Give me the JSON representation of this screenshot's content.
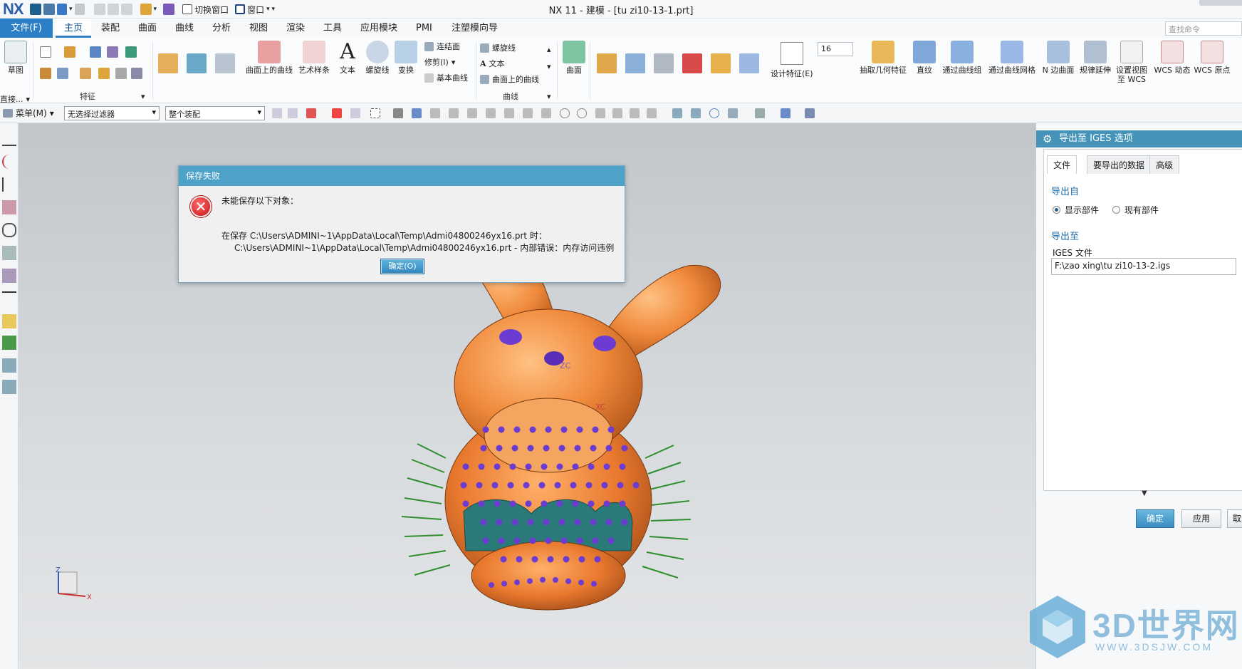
{
  "app": {
    "logo": "NX",
    "window_title": "NX 11 - 建模 - [tu zi10-13-1.prt]"
  },
  "quick_access": {
    "switch_window": "切换窗口",
    "window": "窗口"
  },
  "menu": {
    "file": "文件(F)",
    "tabs": [
      "主页",
      "装配",
      "曲面",
      "曲线",
      "分析",
      "视图",
      "渲染",
      "工具",
      "应用模块",
      "PMI",
      "注塑模向导"
    ],
    "search_placeholder": "查找命令"
  },
  "ribbon": {
    "sketch": "草图",
    "direct_label": "直接...",
    "feature_group": "特征",
    "curve_on_surface": "曲面上的曲线",
    "art_spline": "艺术样条",
    "text": "文本",
    "helix": "螺旋线",
    "transform": "变换",
    "bridge_curve": "连结面",
    "trim": "修剪(I)",
    "basic_curves": "基本曲线",
    "helix_small": "螺旋线",
    "text_small": "文本",
    "curve_on_surface_small": "曲面上的曲线",
    "curve_group": "曲线",
    "surface": "曲面",
    "design_feature": "设计特征(E)",
    "font_size": "16",
    "extract_geometry": "抽取几何特征",
    "ruled": "直纹",
    "through_curves": "通过曲线组",
    "through_curve_mesh": "通过曲线网格",
    "n_sided": "N 边曲面",
    "law_extension": "规律延伸",
    "set_view_wcs_1": "设置视图",
    "set_view_wcs_2": "至 WCS",
    "wcs_dynamic": "WCS 动态",
    "wcs_origin": "WCS 原点"
  },
  "selection_bar": {
    "menu": "菜单(M)",
    "filter": "无选择过滤器",
    "scope": "整个装配"
  },
  "dialog": {
    "title": "保存失败",
    "message": "未能保存以下对象：",
    "detail_line1": "在保存 C:\\Users\\ADMINI~1\\AppData\\Local\\Temp\\Admi04800246yx16.prt 时：",
    "detail_line2": "C:\\Users\\ADMINI~1\\AppData\\Local\\Temp\\Admi04800246yx16.prt - 内部错误：内存访问违例",
    "ok": "确定(O)"
  },
  "panel": {
    "title": "导出至 IGES 选项",
    "tabs": [
      "文件",
      "要导出的数据",
      "高级"
    ],
    "export_from": "导出自",
    "radio_displayed": "显示部件",
    "radio_existing": "现有部件",
    "export_to": "导出至",
    "iges_file_label": "IGES 文件",
    "iges_file_value": "F:\\zao xing\\tu zi10-13-2.igs",
    "ok": "确定",
    "apply": "应用",
    "cancel": "取消"
  },
  "viewport": {
    "zc_label": "ZC",
    "xc_label": "XC",
    "axis_z": "Z",
    "axis_x": "X"
  },
  "watermark": {
    "brand": "3D世界网",
    "url": "WWW.3DSJW.COM"
  },
  "colors": {
    "accent": "#2c7fc4",
    "dialog_title": "#4ea1c7",
    "model_orange": "#f08a3c",
    "dots_purple": "#6c3bd1"
  }
}
